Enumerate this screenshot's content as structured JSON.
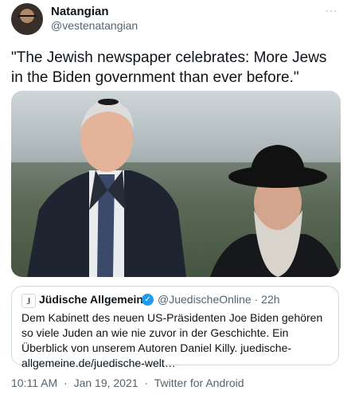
{
  "author": {
    "display_name": "Natangian",
    "handle": "@vestenatangian",
    "avatar_icon": "user-avatar"
  },
  "more_icon": "···",
  "tweet": {
    "text": "\"The Jewish newspaper celebrates: More Jews in the Biden government than ever before.\""
  },
  "quoted": {
    "logo_letter": "J",
    "name": "Jüdische Allgemeine",
    "verified_icon": "✓",
    "handle_time": "@JuedischeOnline · 22h",
    "text": "Dem Kabinett des neuen US-Präsidenten Joe Biden gehören so viele Juden an wie nie zuvor in der Geschichte. Ein Überblick von unserem Autoren Daniel Killy. juedische-allgemeine.de/juedische-welt…"
  },
  "meta": {
    "time": "10:11 AM",
    "dot1": "·",
    "date": "Jan 19, 2021",
    "dot2": "·",
    "source": "Twitter for Android"
  },
  "colors": {
    "accent": "#1d9bf0",
    "secondary_text": "#536471",
    "border": "#cfd9de"
  }
}
